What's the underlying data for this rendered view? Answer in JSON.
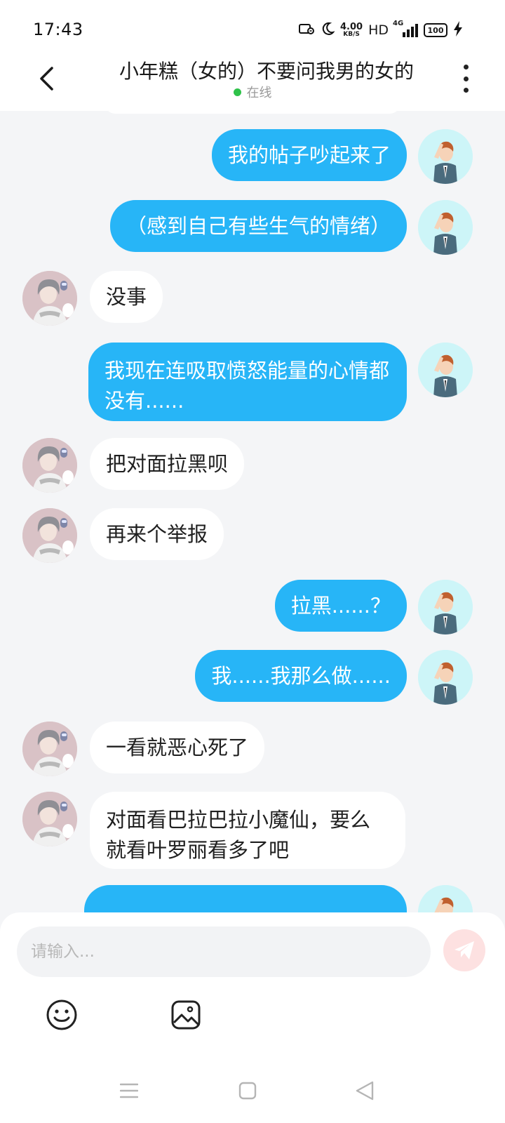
{
  "status_bar": {
    "time": "17:43",
    "net_speed_value": "4.00",
    "net_speed_unit": "KB/S",
    "hd_label": "HD",
    "network_label": "4G",
    "battery_level": "100"
  },
  "header": {
    "title": "小年糕（女的）不要问我男的女的",
    "status": "在线"
  },
  "messages": [
    {
      "sender": "me",
      "text": "我的帖子吵起来了"
    },
    {
      "sender": "me",
      "text": "（感到自己有些生气的情绪）"
    },
    {
      "sender": "them",
      "text": "没事"
    },
    {
      "sender": "me",
      "text": "我现在连吸取愤怒能量的心情都没有......"
    },
    {
      "sender": "them",
      "text": "把对面拉黑呗"
    },
    {
      "sender": "them",
      "text": "再来个举报"
    },
    {
      "sender": "me",
      "text": "拉黑......？"
    },
    {
      "sender": "me",
      "text": "我......我那么做......"
    },
    {
      "sender": "them",
      "text": "一看就恶心死了"
    },
    {
      "sender": "them",
      "text": "对面看巴拉巴拉小魔仙，要么就看叶罗丽看多了吧"
    }
  ],
  "composer": {
    "placeholder": "请输入..."
  },
  "colors": {
    "my_bubble": "#27b5f7",
    "their_bubble": "#ffffff",
    "background": "#f4f5f7",
    "online_dot": "#2fc24a",
    "send_button": "#fde1e1"
  },
  "icons": [
    "back-arrow-icon",
    "more-vertical-icon",
    "send-icon",
    "emoji-icon",
    "image-icon",
    "menu-icon",
    "home-square-icon",
    "back-triangle-icon"
  ]
}
